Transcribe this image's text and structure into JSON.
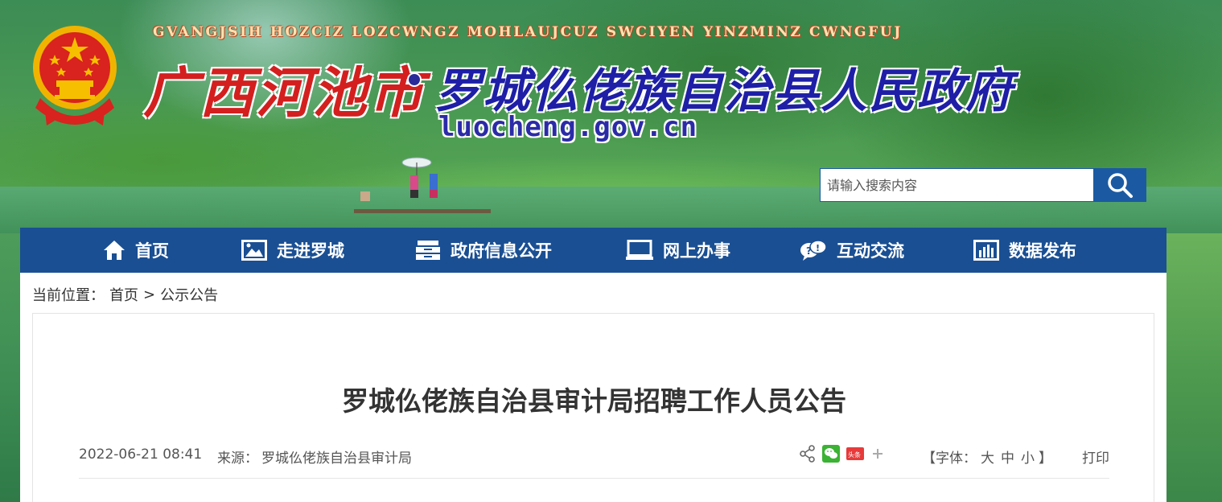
{
  "header": {
    "pinyin": "GVANGJSIH HOZCIZ LOZCWNGZ MOHLAUJCUZ SWCIYEN YINZMINZ CWNGFUJ",
    "title_city": "广西河池市",
    "title_county": "罗城仫佬族自治县人民政府",
    "domain": "luocheng.gov.cn"
  },
  "search": {
    "placeholder": "请输入搜索内容",
    "icon": "search-icon"
  },
  "nav": {
    "items": [
      {
        "label": "首页",
        "icon": "home-icon"
      },
      {
        "label": "走进罗城",
        "icon": "picture-icon"
      },
      {
        "label": "政府信息公开",
        "icon": "archive-icon"
      },
      {
        "label": "网上办事",
        "icon": "monitor-icon"
      },
      {
        "label": "互动交流",
        "icon": "chat-icon"
      },
      {
        "label": "数据发布",
        "icon": "bar-chart-icon"
      }
    ]
  },
  "breadcrumb": {
    "prefix": "当前位置：",
    "home": "首页",
    "separator": ">",
    "current": "公示公告"
  },
  "article": {
    "title": "罗城仫佬族自治县审计局招聘工作人员公告",
    "date": "2022-06-21 08:41",
    "source_label": "来源：",
    "source": "罗城仫佬族自治县审计局",
    "share_icons": [
      "share-icon",
      "wechat-icon",
      "toutiao-icon",
      "plus-icon"
    ],
    "toutiao_label": "头条",
    "font_open": "【字体：",
    "font_large": "大",
    "font_medium": "中",
    "font_small": "小",
    "font_close": "】",
    "print": "打印"
  },
  "colors": {
    "nav_bg": "#1a4f93",
    "search_btn": "#1b5aa2",
    "title_red": "#d41f1f",
    "title_blue": "#1e1fa6"
  }
}
